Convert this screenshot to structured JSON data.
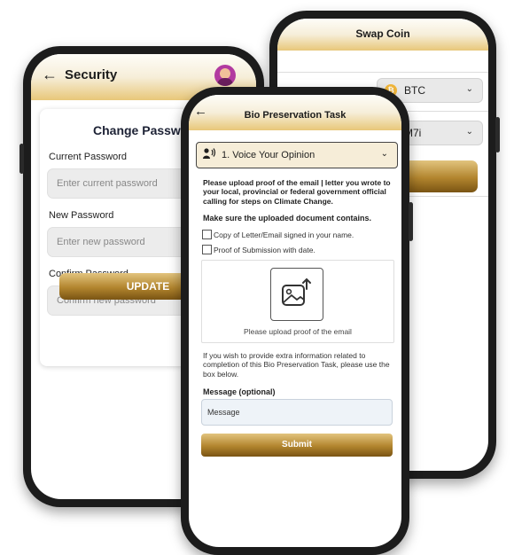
{
  "security": {
    "title": "Security",
    "card_title": "Change Passw",
    "current_label": "Current Password",
    "current_placeholder": "Enter current password",
    "new_label": "New Password",
    "new_placeholder": "Enter new password",
    "confirm_label": "Confirm Password",
    "confirm_placeholder": "Confirm new password",
    "update_label": "UPDATE"
  },
  "swap": {
    "title": "Swap Coin",
    "from_coin": "BTC",
    "to_coin": "M7i"
  },
  "bio": {
    "title": "Bio Preservation Task",
    "accordion_label": "1. Voice Your Opinion",
    "instructions": "Please upload proof of the email | letter you wrote to your local, provincial or federal government official calling for steps on Climate Change.",
    "requirement_heading": "Make sure the uploaded document contains.",
    "checklist": [
      "Copy of Letter/Email signed in your name.",
      "Proof of Submission with date."
    ],
    "upload_text": "Please upload proof of the email",
    "extra_info": "If you wish to provide extra information related to completion of this Bio Preservation Task, please use the box below.",
    "message_label": "Message (optional)",
    "message_placeholder": "Message",
    "submit_label": "Submit"
  },
  "icons": {
    "back": "arrow-left-icon",
    "avatar": "user-avatar",
    "chevron": "chevron-down-icon",
    "btc": "bitcoin-icon",
    "voice": "voice-icon",
    "upload": "image-upload-icon"
  },
  "colors": {
    "gold_dark": "#7a5413",
    "gold_light": "#e2c47e",
    "accordion_bg": "#f6edd8",
    "bitcoin": "#f1b63a"
  }
}
